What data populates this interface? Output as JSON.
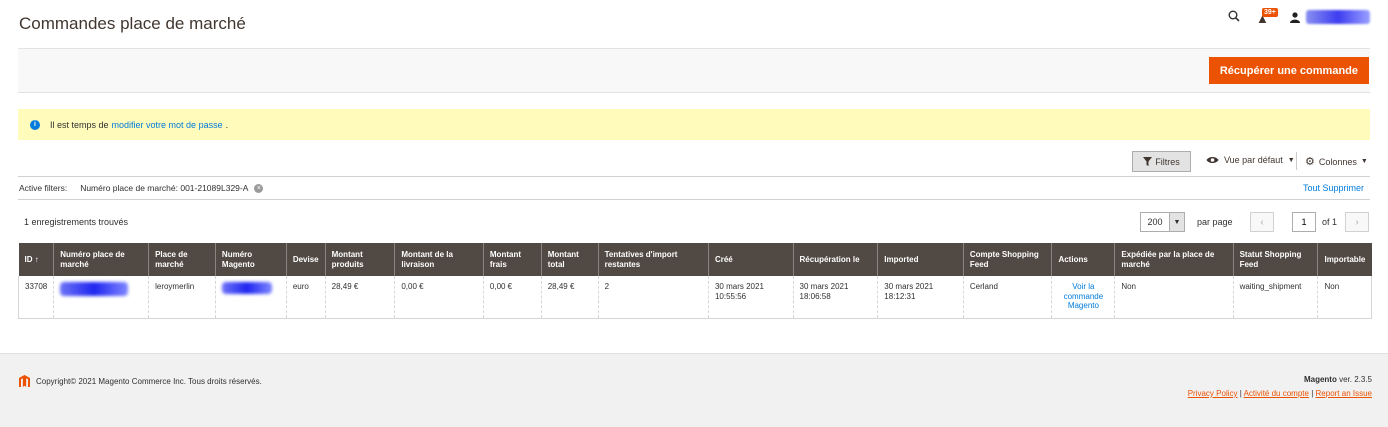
{
  "header": {
    "title": "Commandes place de marché",
    "notification_count": "39+"
  },
  "action_bar": {
    "primary_button": "Récupérer une commande"
  },
  "message": {
    "prefix": "Il est temps de",
    "link": "modifier votre mot de passe",
    "suffix": "."
  },
  "toolbar": {
    "filters": "Filtres",
    "view": "Vue par défaut",
    "columns": "Colonnes"
  },
  "active_filters": {
    "label": "Active filters:",
    "chip": "Numéro place de marché: 001-21089L329-A",
    "clear_all": "Tout Supprimer"
  },
  "pager": {
    "records": "1 enregistrements trouvés",
    "per_page_value": "200",
    "per_page_label": "par page",
    "current_page": "1",
    "of_pages": "of 1"
  },
  "table": {
    "columns": [
      "ID ↑",
      "Numéro place de marché",
      "Place de marché",
      "Numéro Magento",
      "Devise",
      "Montant produits",
      "Montant de la livraison",
      "Montant frais",
      "Montant total",
      "Tentatives d'import restantes",
      "Créé",
      "Récupération le",
      "Imported",
      "Compte Shopping Feed",
      "Actions",
      "Expédiée par la place de marché",
      "Statut Shopping Feed",
      "Importable"
    ],
    "rows": [
      {
        "id": "33708",
        "marketplace": "leroymerlin",
        "currency": "euro",
        "products_amount": "28,49 €",
        "shipping_amount": "0,00 €",
        "fees_amount": "0,00 €",
        "total_amount": "28,49 €",
        "attempts": "2",
        "created_date": "30 mars 2021",
        "created_time": "10:55:56",
        "fetched_date": "30 mars 2021",
        "fetched_time": "18:06:58",
        "imported_date": "30 mars 2021",
        "imported_time": "18:12:31",
        "account": "Cerland",
        "action_label": "Voir la commande Magento",
        "shipped_by_marketplace": "Non",
        "sf_status": "waiting_shipment",
        "importable": "Non"
      }
    ]
  },
  "footer": {
    "copyright": "Copyright© 2021 Magento Commerce Inc. Tous droits réservés.",
    "brand": "Magento",
    "version": "ver. 2.3.5",
    "links": [
      "Privacy Policy",
      "Activité du compte",
      "Report an Issue"
    ]
  },
  "colors": {
    "accent": "#eb5202",
    "table_header": "#514943",
    "link": "#007bdb",
    "message_bg": "#fffbbb"
  }
}
